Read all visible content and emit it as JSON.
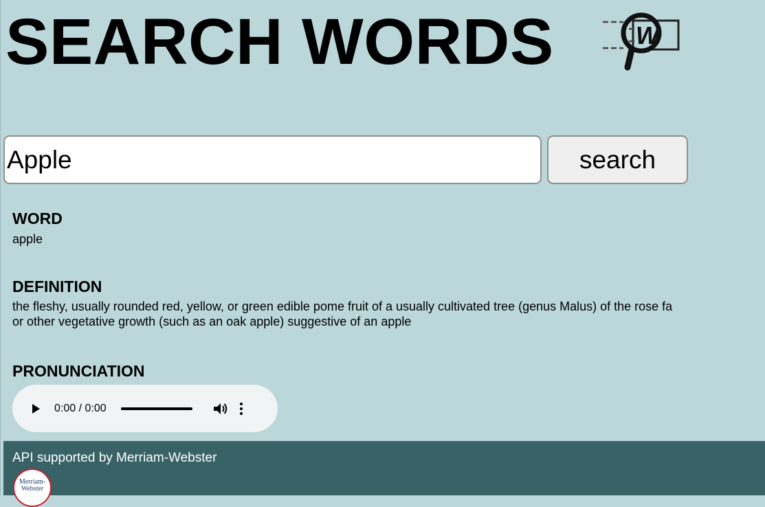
{
  "header": {
    "title": "SEARCH WORDS",
    "logo_icon": "magnifier-w-logo-icon",
    "logo_letter": "W"
  },
  "search": {
    "value": "Apple",
    "button_label": "search"
  },
  "result": {
    "word_heading": "WORD",
    "word": "apple",
    "definition_heading": "DEFINITION",
    "definition_lines": [
      "the fleshy, usually rounded red, yellow, or green edible pome fruit of a usually cultivated tree (genus Malus) of the rose fa",
      "or other vegetative growth (such as an oak apple) suggestive of an apple"
    ],
    "pronunciation_heading": "PRONUNCIATION"
  },
  "audio": {
    "time": "0:00 / 0:00",
    "progress": 0,
    "icons": [
      "play-icon",
      "volume-icon",
      "more-options-icon"
    ]
  },
  "footer": {
    "text": "API supported by Merriam-Webster",
    "logo_text": [
      "Merriam-",
      "Webster"
    ]
  },
  "colors": {
    "background": "#bbd7da",
    "footer": "#386266",
    "mw_red": "#c8202d",
    "mw_blue": "#1f3f74"
  }
}
